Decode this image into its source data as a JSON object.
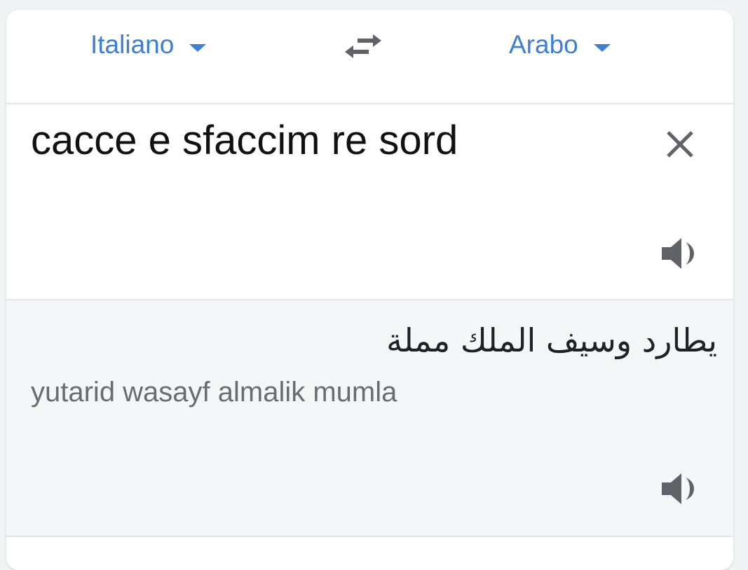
{
  "language_bar": {
    "source_language": "Italiano",
    "target_language": "Arabo",
    "icons": {
      "source_dropdown": "chevron-down-icon",
      "swap": "swap-languages-icon",
      "target_dropdown": "chevron-down-icon"
    },
    "accent_color": "#3d7fd6"
  },
  "input": {
    "text": "cacce e sfaccim re sord",
    "icons": {
      "clear": "close-icon",
      "listen": "speaker-icon"
    }
  },
  "output": {
    "translation": "يطارد وسيف الملك مملة",
    "transliteration": "yutarid wasayf almalik mumla",
    "icons": {
      "listen": "speaker-icon"
    },
    "background_color": "#f5f6f8"
  }
}
